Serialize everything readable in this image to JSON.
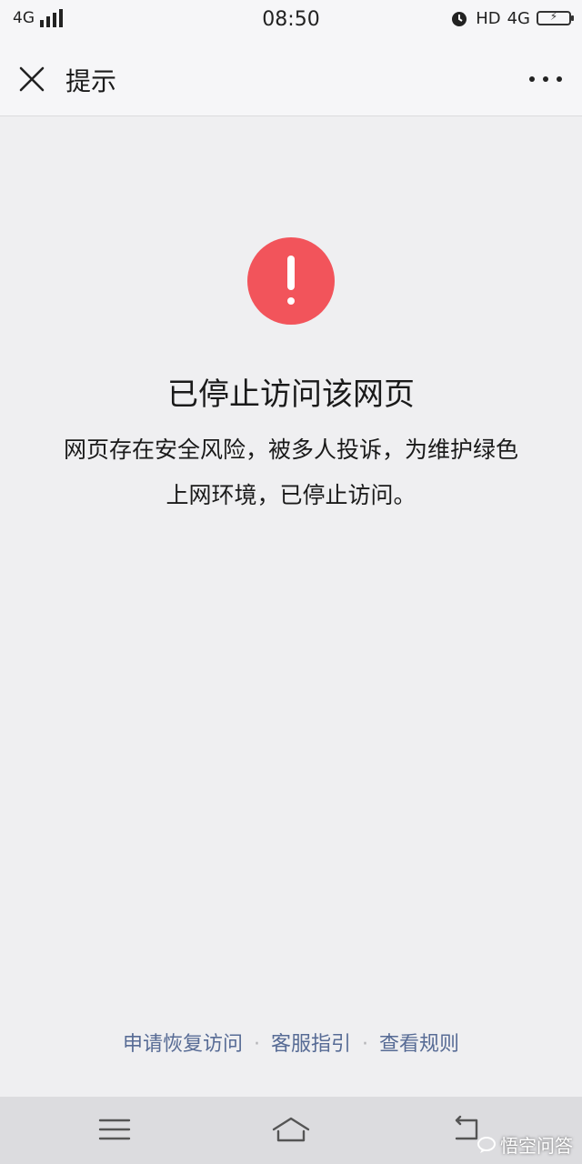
{
  "status_bar": {
    "network": "4G",
    "time": "08:50",
    "hd": "HD",
    "network_right": "4G"
  },
  "header": {
    "title": "提示"
  },
  "main": {
    "heading": "已停止访问该网页",
    "description": "网页存在安全风险，被多人投诉，为维护绿色上网环境，已停止访问。"
  },
  "footer_links": {
    "appeal": "申请恢复访问",
    "support": "客服指引",
    "rules": "查看规则",
    "separator": "·"
  },
  "watermark": {
    "text": "悟空问答"
  },
  "colors": {
    "alert": "#f2545b",
    "link": "#576b95",
    "background": "#efeff1"
  }
}
